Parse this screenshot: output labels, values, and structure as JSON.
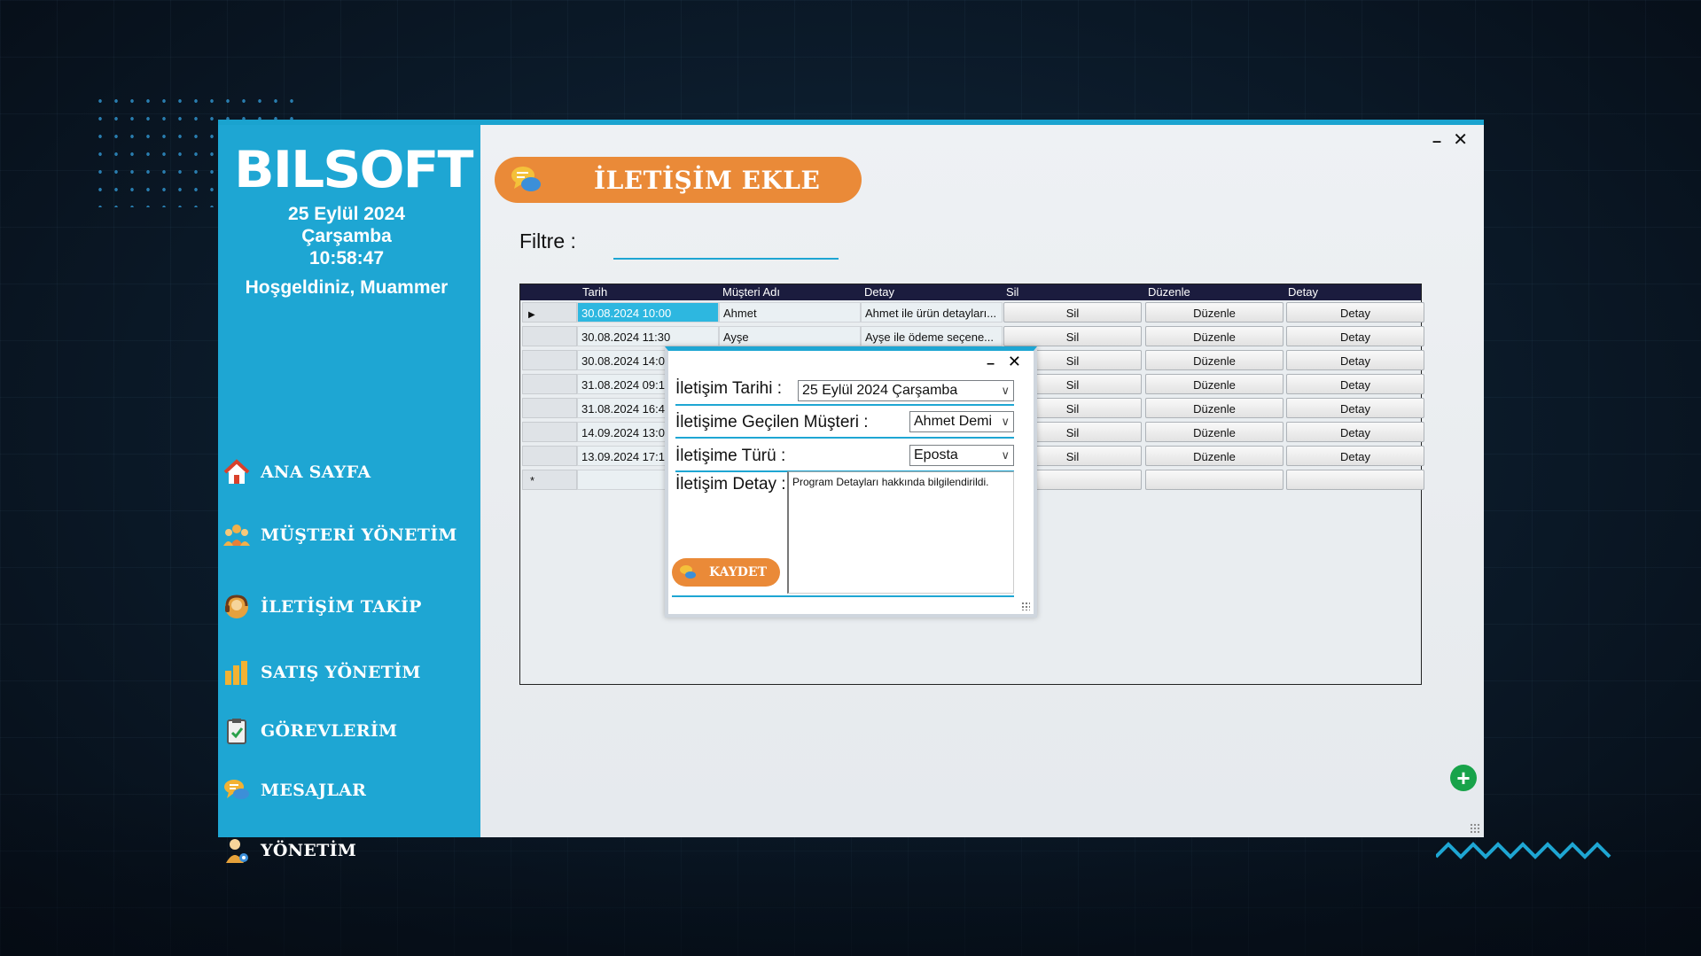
{
  "app": {
    "brand": "BILSOFT",
    "date": "25 Eylül 2024",
    "weekday": "Çarşamba",
    "time": "10:58:47",
    "welcome": "Hoşgeldiniz, Muammer",
    "window_minimize": "–",
    "window_close": "✕"
  },
  "sidebar": {
    "items": [
      {
        "label": "ANA SAYFA",
        "icon": "home-icon"
      },
      {
        "label": "MÜŞTERİ YÖNETİM",
        "icon": "customers-icon"
      },
      {
        "label": "İLETİŞİM TAKİP",
        "icon": "contact-icon"
      },
      {
        "label": "SATIŞ YÖNETİM",
        "icon": "bar-chart-icon"
      },
      {
        "label": "GÖREVLERİM",
        "icon": "clipboard-icon"
      },
      {
        "label": "MESAJLAR",
        "icon": "chat-icon"
      },
      {
        "label": "YÖNETİM",
        "icon": "admin-icon"
      }
    ]
  },
  "main": {
    "title": "İLETİŞİM EKLE",
    "filter_label": "Filtre :",
    "filter_value": ""
  },
  "grid": {
    "columns": [
      "Tarih",
      "Müşteri Adı",
      "Detay",
      "Sil",
      "Düzenle",
      "Detay"
    ],
    "rows": [
      {
        "date": "30.08.2024 10:00",
        "name": "Ahmet",
        "detail": "Ahmet ile ürün detayları..."
      },
      {
        "date": "30.08.2024 11:30",
        "name": "Ayşe",
        "detail": "Ayşe ile ödeme seçene..."
      },
      {
        "date": "30.08.2024 14:0",
        "name": "",
        "detail": ""
      },
      {
        "date": "31.08.2024 09:1",
        "name": "",
        "detail": ""
      },
      {
        "date": "31.08.2024 16:4",
        "name": "",
        "detail": ""
      },
      {
        "date": "14.09.2024 13:0",
        "name": "",
        "detail": ""
      },
      {
        "date": "13.09.2024 17:1",
        "name": "",
        "detail": ""
      }
    ],
    "btn_sil": "Sil",
    "btn_duzenle": "Düzenle",
    "btn_detay": "Detay",
    "current_row_marker": "▶",
    "new_row_marker": "*",
    "add_button": "+"
  },
  "dialog": {
    "minimize": "–",
    "close": "✕",
    "date_label": "İletişim Tarihi :",
    "date_value": "25   Eylül   2024 Çarşamba",
    "customer_label": "İletişime Geçilen Müşteri :",
    "customer_value": "Ahmet Demi",
    "type_label": "İletişime Türü :",
    "type_value": "Eposta",
    "detail_label": "İletişim Detay :",
    "detail_value": "Program Detayları hakkında bilgilendirildi.",
    "save_label": "KAYDET"
  },
  "colors": {
    "sidebar": "#1ea6d3",
    "accent_orange": "#ea8a38",
    "grid_header": "#1b1c3e",
    "selected_cell": "#2db7e0",
    "add_green": "#18a34a"
  }
}
